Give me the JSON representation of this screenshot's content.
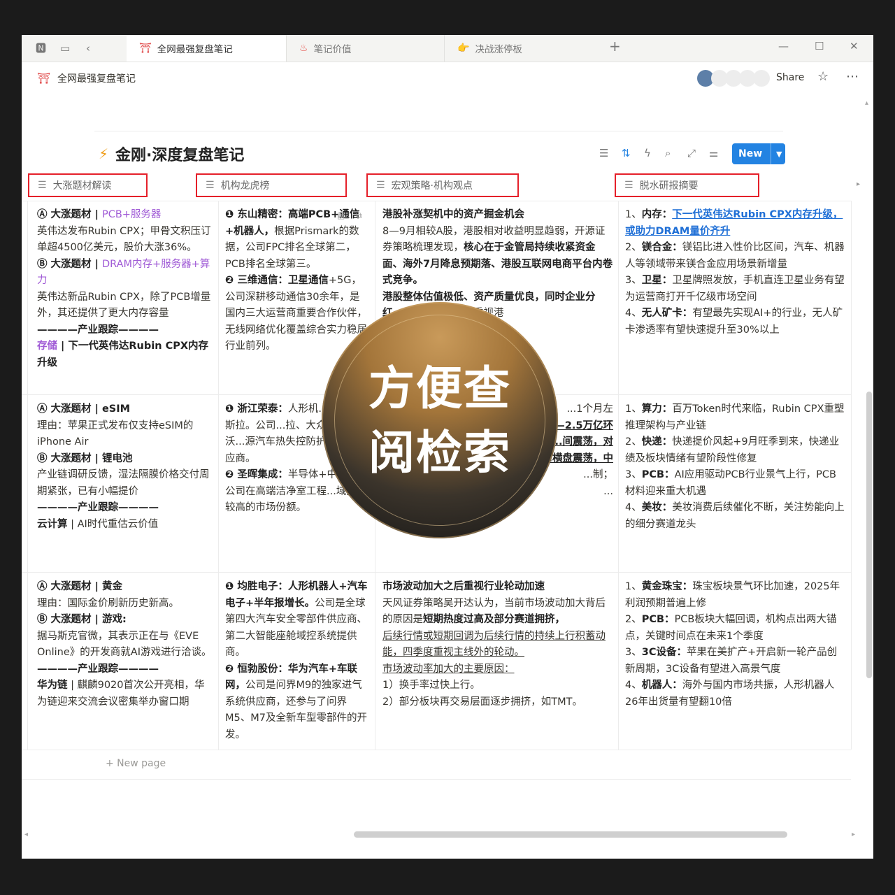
{
  "tabs": [
    {
      "icon": "⛩",
      "label": "全网最强复盘笔记",
      "active": true
    },
    {
      "icon": "♨",
      "label": "笔记价值",
      "active": false
    },
    {
      "icon": "👉",
      "label": "决战涨停板",
      "active": false
    }
  ],
  "breadcrumb": "全网最强复盘笔记",
  "share_label": "Share",
  "db_title": "金刚·深度复盘笔记",
  "new_label": "New",
  "columns": [
    "大涨题材解读",
    "机构龙虎榜",
    "宏观策略·机构观点",
    "脱水研报摘要"
  ],
  "rows": [
    {
      "c1": {
        "a_label": "Ⓐ 大涨题材 | ",
        "a_theme": "PCB+服务器",
        "a_text": "英伟达发布Rubin CPX；甲骨文积压订单超4500亿美元，股价大涨36%。",
        "b_label": "Ⓑ 大涨题材 | ",
        "b_theme": "DRAM内存+服务器+算力",
        "b_text": "英伟达新品Rubin CPX，除了PCB增量外，其还提供了更大内存容量",
        "track": "————产业跟踪————",
        "track_tag": "存储",
        "track_text": " | 下一代英伟达Rubin CPX内存升级"
      },
      "c2": {
        "p1_head": "❶ 东山精密：高端PCB+通信+机器人，",
        "p1_text": "根据Prismark的数据，公司FPC排名全球第二，PCB排名全球第三。",
        "p2_head": "❷ 三维通信：卫星通信",
        "p2_text": "+5G，公司深耕移动通信30余年，是国内三大运营商重要合作伙伴，无线网络优化覆盖综合实力稳居行业前列。"
      },
      "c3": {
        "head": "港股补涨契机中的资产掘金机会",
        "t1": "8—9月相较A股，港股相对收益明显趋弱，开源证券策略梳理发现，",
        "t1b": "核心在于金管局持续收紧资金面、海外7月降息预期落、港股互联网电商平台内卷式竞争。",
        "t2b": "港股整体估值极低、资产质量优良，同时企业分红",
        "t2": "...建议在这一阶段重视港",
        "t3b": "...以及弹性较强的非",
        "t4": "...估值修复带来的"
      },
      "c4": {
        "l1_num": "1、",
        "l1_head": "内存：",
        "l1_link": "下一代英伟达Rubin CPX内存升级，或助力DRAM量价齐升",
        "l2_num": "2、",
        "l2_head": "镁合金：",
        "l2_text": "镁铝比进入性价比区间，汽车、机器人等领域带来镁合金应用场景新增量",
        "l3_num": "3、",
        "l3_head": "卫星：",
        "l3_text": "卫星牌照发放，手机直连卫星业务有望为运营商打开千亿级市场空间",
        "l4_num": "4、",
        "l4_head": "无人矿卡：",
        "l4_text": "有望最先实现AI+的行业，无人矿卡渗透率有望快速提升至30%以上"
      }
    },
    {
      "c1": {
        "a_label": "Ⓐ 大涨题材 | ",
        "a_theme": "eSIM",
        "a_text": "理由：苹果正式发布仅支持eSIM的iPhone Air",
        "b_label": "Ⓑ 大涨题材 | ",
        "b_theme": "锂电池",
        "b_text": "产业链调研反馈，湿法隔膜价格交付周期紧张，已有小幅提价",
        "track": "————产业跟踪————",
        "track_tag": "云计算",
        "track_text": " | AI时代重估云价值"
      },
      "c2": {
        "p1_head": "❶ 浙江荣泰：",
        "p1_text": "人形机...速器+特斯拉。公司...拉、大众、宝马、沃...源汽车热失控防护绝缘...供应商。",
        "p2_head": "❷ 圣晖集成：",
        "p2_text": "半导体+中...际。公司在高端洁净室工程...域拥有较高的市场份额。"
      },
      "c3": {
        "t1": "...1个月左",
        "t2": "...—2.5万亿环",
        "t3": "...间震荡，对",
        "t4": "...横盘震荡，中",
        "t5": "...制；",
        "t6": "..."
      },
      "c4": {
        "l1_num": "1、",
        "l1_head": "算力：",
        "l1_text": "百万Token时代来临，Rubin CPX重塑推理架构与产业链",
        "l2_num": "2、",
        "l2_head": "快递：",
        "l2_text": "快递提价风起+9月旺季到来，快递业绩及板块情绪有望阶段性修复",
        "l3_num": "3、",
        "l3_head": "PCB：",
        "l3_text": "AI应用驱动PCB行业景气上行，PCB材料迎来重大机遇",
        "l4_num": "4、",
        "l4_head": "美妆：",
        "l4_text": "美妆消费后续催化不断，关注势能向上的细分赛道龙头"
      }
    },
    {
      "c1": {
        "a_label": "Ⓐ 大涨题材 | ",
        "a_theme": "黄金",
        "a_text": "理由：国际金价刷新历史新高。",
        "b_label": "Ⓑ 大涨题材 | ",
        "b_theme": "游戏:",
        "b_text": "据马斯克官微，其表示正在与《EVE Online》的开发商就AI游戏进行洽谈。",
        "track": "————产业跟踪————",
        "track_tag": "华为链",
        "track_text": " | 麒麟9020首次公开亮相，华为链迎来交流会议密集举办窗口期"
      },
      "c2": {
        "p1_head": "❶ 均胜电子：人形机器人+汽车电子+半年报增长。",
        "p1_text": "公司是全球第四大汽车安全零部件供应商、第二大智能座舱域控系统提供商。",
        "p2_head": "❷ 恒勃股份：华为汽车+车联网，",
        "p2_text": "公司是问界M9的独家进气系统供应商，还参与了问界M5、M7及全新车型零部件的开发。"
      },
      "c3": {
        "head": "市场波动加大之后重视行业轮动加速",
        "t1": "天风证券策略吴开达认为，当前市场波动加大背后的原因是",
        "t1b": "短期热度过高及部分赛道拥挤，",
        "t1u": "后续行情或短期回调为后续行情的持续上行积蓄动能，四季度重视主线外的轮动。",
        "t2u": "市场波动率加大的主要原因：",
        "l1": "1）换手率过快上行。",
        "l2": "2）部分板块再交易层面逐步拥挤，如TMT。"
      },
      "c4": {
        "l1_num": "1、",
        "l1_head": "黄金珠宝：",
        "l1_text": "珠宝板块景气环比加速，2025年利润预期普遍上修",
        "l2_num": "2、",
        "l2_head": "PCB：",
        "l2_text": "PCB板块大幅回调，机构点出两大锚点，关键时间点在未来1个季度",
        "l3_num": "3、",
        "l3_head": "3C设备：",
        "l3_text": "苹果在美扩产+开启新一轮产品创新周期，3C设备有望进入高景气度",
        "l4_num": "4、",
        "l4_head": "机器人：",
        "l4_text": "海外与国内市场共振，人形机器人26年出货量有望翻10倍"
      }
    }
  ],
  "new_page_label": "+  New page",
  "badge": {
    "line1": "方便查",
    "line2": "阅检索"
  }
}
